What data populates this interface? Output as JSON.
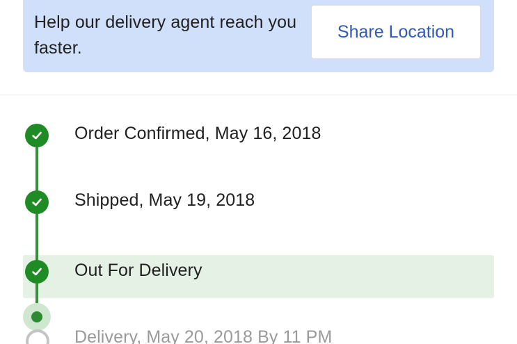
{
  "banner": {
    "message": "Help our delivery agent reach you faster.",
    "share_button_label": "Share Location",
    "background_color": "#d0e0fa",
    "button_text_color": "#2f5bb4"
  },
  "timeline": {
    "accent_color": "#1f8b24",
    "highlight_color": "#e6f1e6",
    "steps": [
      {
        "label": "Order Confirmed, May 16, 2018",
        "status": "completed",
        "icon": "checkmark-icon"
      },
      {
        "label": "Shipped, May 19, 2018",
        "status": "completed",
        "icon": "checkmark-icon"
      },
      {
        "label": "Out For Delivery",
        "status": "current",
        "icon": "checkmark-icon"
      },
      {
        "label": "Delivery, May 20, 2018 By 11 PM",
        "status": "pending",
        "icon": "empty-circle-icon"
      }
    ]
  }
}
